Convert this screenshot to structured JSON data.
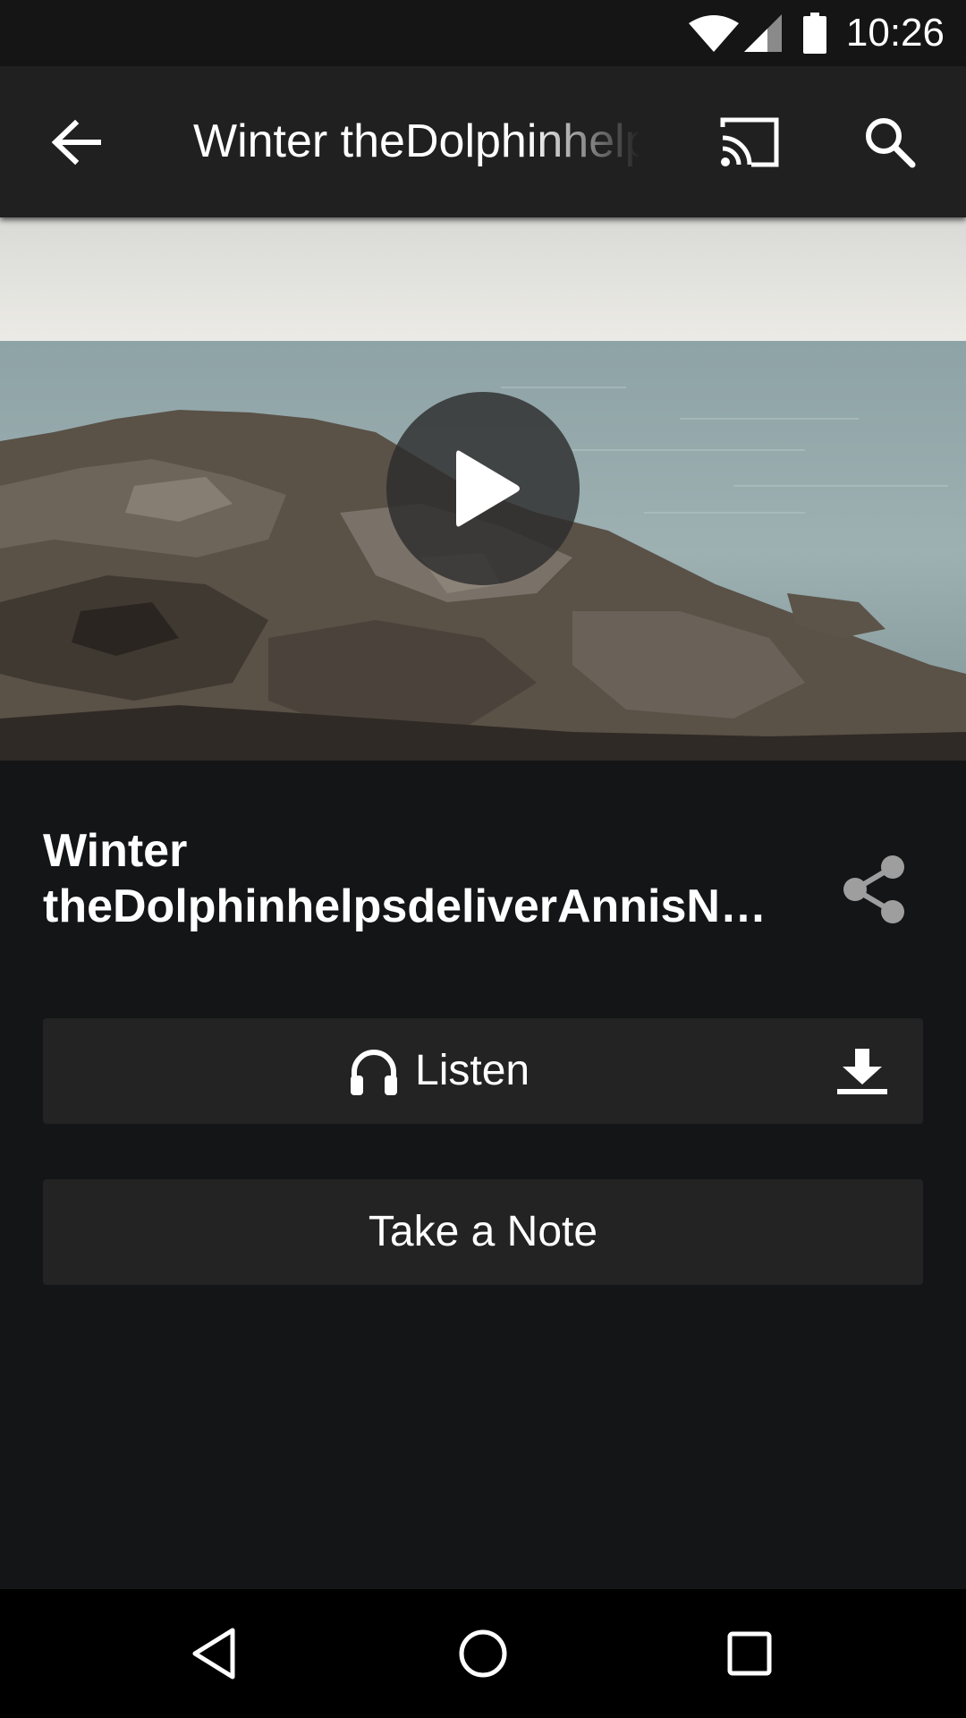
{
  "status_bar": {
    "time": "10:26",
    "icons": [
      "wifi-icon",
      "signal-icon",
      "battery-icon"
    ]
  },
  "app_bar": {
    "title": "Winter theDolphinhelpsdeliverAnnisN...",
    "actions": [
      "cast-icon",
      "search-icon"
    ]
  },
  "hero": {
    "image": "rocky-seashore-photo",
    "play_icon": "play-icon"
  },
  "episode": {
    "title_line1": "Winter",
    "title_line2": "theDolphinhelpsdeliverAnnisN…"
  },
  "actions": {
    "listen_label": "Listen",
    "note_label": "Take a Note"
  },
  "colors": {
    "background": "#141517",
    "app_bar": "#202020",
    "button": "#232323",
    "text": "#ffffff",
    "share_icon": "#9e9e9e"
  }
}
